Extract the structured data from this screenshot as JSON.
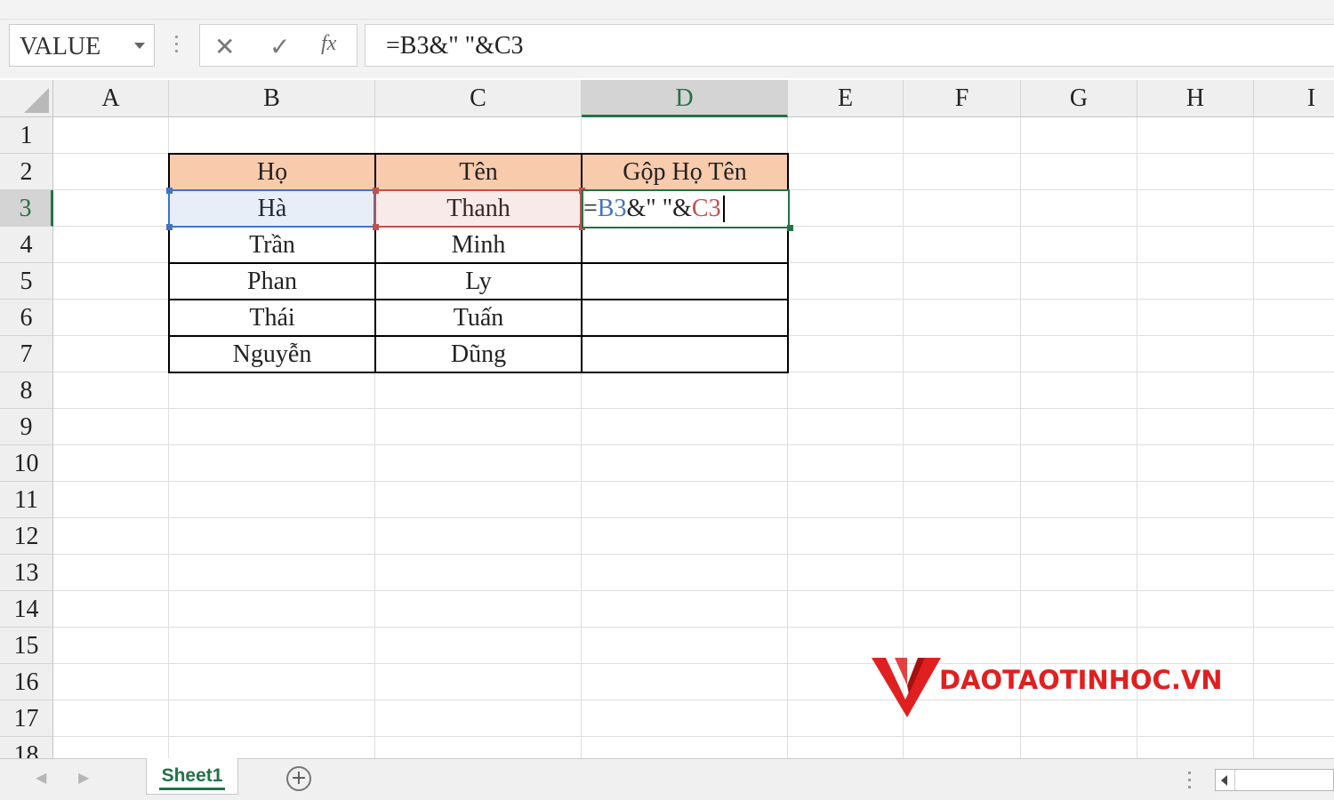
{
  "name_box": {
    "value": "VALUE"
  },
  "formula_bar": {
    "cancel_glyph": "✕",
    "enter_glyph": "✓",
    "fx_label": "fx",
    "formula": "=B3&\" \"&C3"
  },
  "columns": [
    "A",
    "B",
    "C",
    "D",
    "E",
    "F",
    "G",
    "H",
    "I"
  ],
  "selected_column": "D",
  "rows": [
    "1",
    "2",
    "3",
    "4",
    "5",
    "6",
    "7",
    "8",
    "9",
    "10",
    "11",
    "12",
    "13",
    "14",
    "15",
    "16",
    "17",
    "18"
  ],
  "selected_row": "3",
  "table": {
    "headers": [
      "Họ",
      "Tên",
      "Gộp Họ Tên"
    ],
    "header_fill": "#f8cbad",
    "rows": [
      [
        "Hà",
        "Thanh"
      ],
      [
        "Trần",
        "Minh"
      ],
      [
        "Phan",
        "Ly"
      ],
      [
        "Thái",
        "Tuấn"
      ],
      [
        "Nguyễn",
        "Dũng"
      ]
    ]
  },
  "edit_cell": {
    "address": "D3",
    "parts": {
      "eq": "=",
      "ref1": "B3",
      "mid": "&\" \"&",
      "ref2": "C3"
    },
    "ref1_color": "#4472c4",
    "ref2_color": "#c0504d"
  },
  "sheet_tabs": {
    "active": "Sheet1",
    "add_glyph": "+"
  },
  "logo": {
    "text": "DAOTAOTINHOC.VN",
    "color": "#e02020"
  },
  "colors": {
    "excel_green": "#217346",
    "grid": "#dedede"
  }
}
